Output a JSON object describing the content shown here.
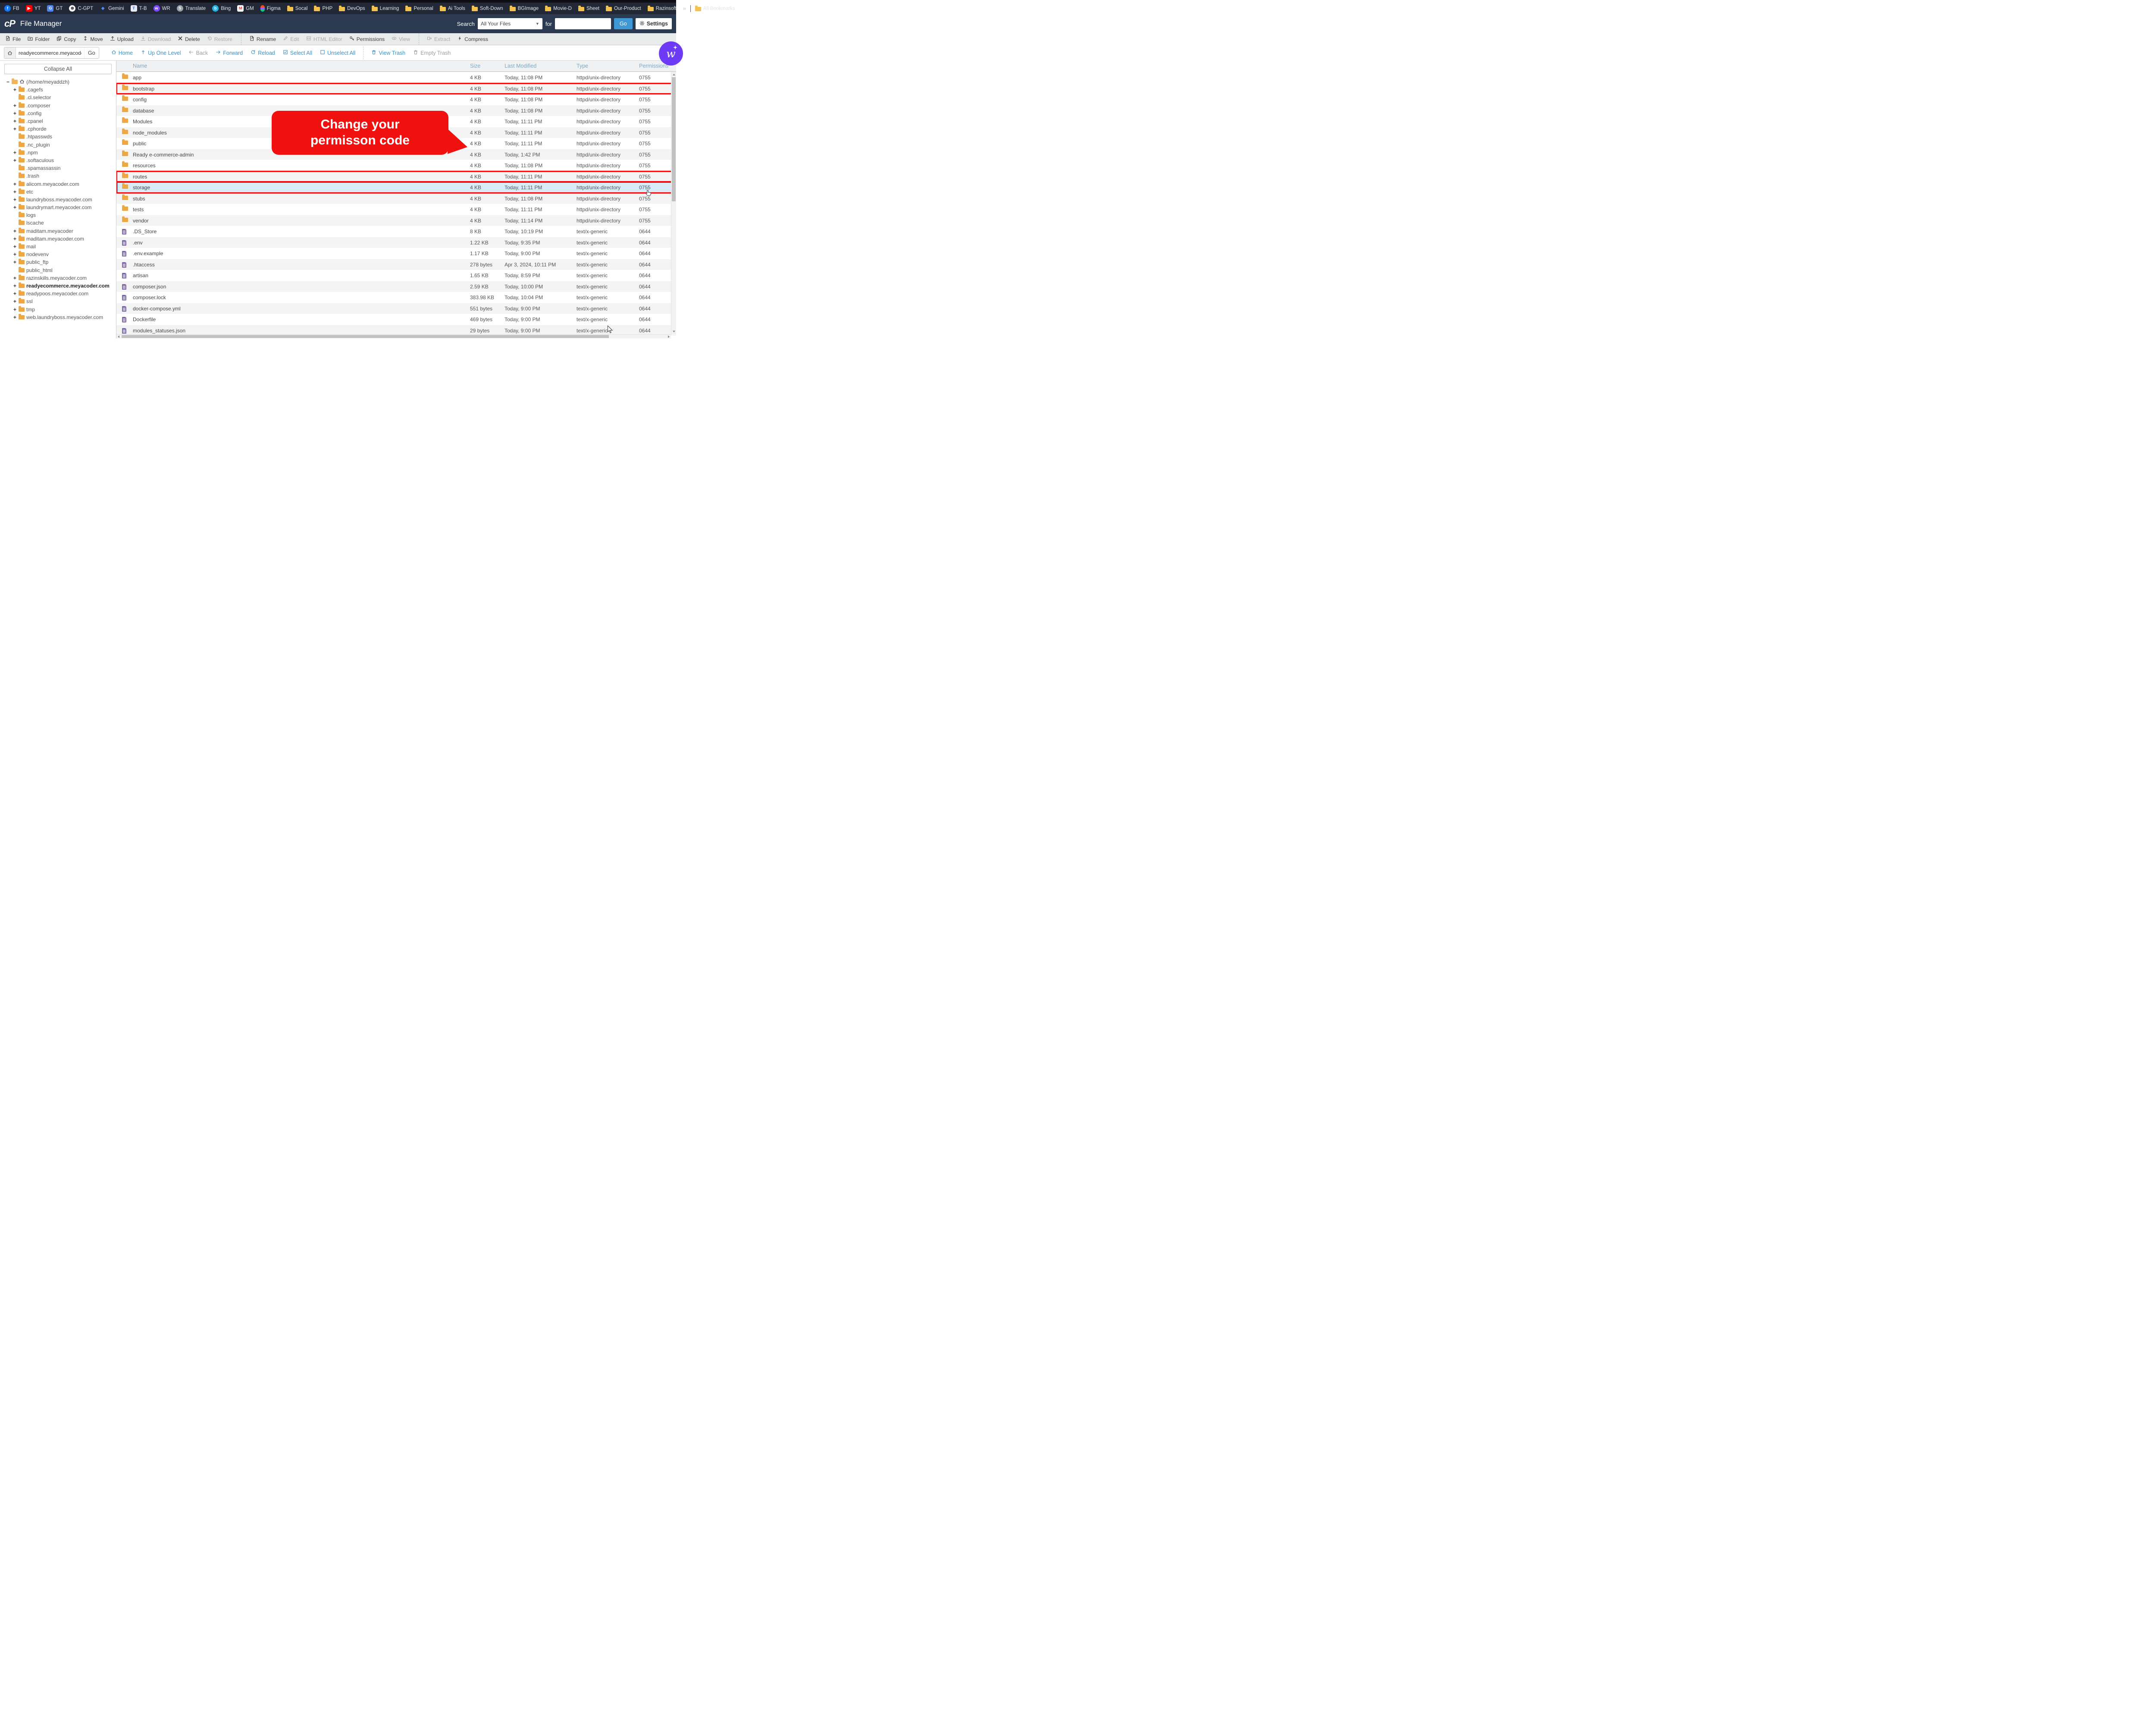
{
  "colors": {
    "accent_blue": "#3f90c4",
    "go_button_blue": "#3e98d3",
    "header_bg": "#2b3a50",
    "bookmark_bar_bg": "#222835",
    "folder_icon": "#eda744",
    "file_icon": "#7e68ab",
    "selected_row_bg": "#d7ebf8",
    "highlight_red": "#ee1111",
    "callout_red": "#f01010",
    "fab_purple": "#6d3bf5"
  },
  "browser": {
    "bookmarks": [
      {
        "label": "FB",
        "kind": "site",
        "shape": "circle",
        "bg": "#1877f2",
        "fg": "#ffffff",
        "glyph": "f"
      },
      {
        "label": "YT",
        "kind": "site",
        "shape": "rounded",
        "bg": "#ff0000",
        "fg": "#ffffff",
        "glyph": "▶"
      },
      {
        "label": "GT",
        "kind": "site",
        "shape": "rounded",
        "bg": "#4f86ec",
        "fg": "#ffffff",
        "glyph": "G"
      },
      {
        "label": "C-GPT",
        "kind": "site",
        "shape": "circle",
        "bg": "#ffffff",
        "fg": "#202123",
        "glyph": "⊛"
      },
      {
        "label": "Gemini",
        "kind": "site",
        "shape": "plain",
        "bg": "transparent",
        "fg": "#4e8df6",
        "glyph": "◆"
      },
      {
        "label": "T-B",
        "kind": "site",
        "shape": "rounded",
        "bg": "#e8ecf9",
        "fg": "#3b5bdb",
        "glyph": "T"
      },
      {
        "label": "WR",
        "kind": "site",
        "shape": "circle",
        "bg": "#7c4dff",
        "fg": "#ffffff",
        "glyph": "w"
      },
      {
        "label": "Translate",
        "kind": "site",
        "shape": "circle",
        "bg": "#9aa0a6",
        "fg": "#ffffff",
        "glyph": "S"
      },
      {
        "label": "Bing",
        "kind": "site",
        "shape": "circle",
        "bg": "#2bb3e6",
        "fg": "#ffffff",
        "glyph": "b"
      },
      {
        "label": "GM",
        "kind": "site",
        "shape": "rounded",
        "bg": "#ffffff",
        "fg": "#ea4335",
        "glyph": "M"
      },
      {
        "label": "Figma",
        "kind": "figma"
      },
      {
        "label": "Socal",
        "kind": "folder"
      },
      {
        "label": "PHP",
        "kind": "folder"
      },
      {
        "label": "DevOps",
        "kind": "folder"
      },
      {
        "label": "Learning",
        "kind": "folder"
      },
      {
        "label": "Personal",
        "kind": "folder"
      },
      {
        "label": "Ai Tools",
        "kind": "folder"
      },
      {
        "label": "Soft-Down",
        "kind": "folder"
      },
      {
        "label": "BGImage",
        "kind": "folder"
      },
      {
        "label": "Movie-D",
        "kind": "folder"
      },
      {
        "label": "Sheet",
        "kind": "folder"
      },
      {
        "label": "Our-Product",
        "kind": "folder"
      },
      {
        "label": "Razinsoft",
        "kind": "folder"
      }
    ],
    "overflow_chevron": "»",
    "all_bookmarks_label": "All Bookmarks"
  },
  "header": {
    "logo": "cP",
    "title": "File Manager",
    "search_label": "Search",
    "search_scope_value": "All Your Files",
    "for_label": "for",
    "search_value": "",
    "go_label": "Go",
    "settings_label": "Settings"
  },
  "toolbar": {
    "items": [
      {
        "label": "File",
        "icon": "file-plus",
        "enabled": true
      },
      {
        "label": "Folder",
        "icon": "folder-plus",
        "enabled": true
      },
      {
        "label": "Copy",
        "icon": "copy",
        "enabled": true
      },
      {
        "label": "Move",
        "icon": "move",
        "enabled": true
      },
      {
        "label": "Upload",
        "icon": "upload",
        "enabled": true
      },
      {
        "label": "Download",
        "icon": "download",
        "enabled": false
      },
      {
        "label": "Delete",
        "icon": "delete",
        "enabled": true
      },
      {
        "label": "Restore",
        "icon": "restore",
        "enabled": false
      },
      {
        "sep": true
      },
      {
        "label": "Rename",
        "icon": "rename",
        "enabled": true
      },
      {
        "label": "Edit",
        "icon": "edit",
        "enabled": false
      },
      {
        "label": "HTML Editor",
        "icon": "html-editor",
        "enabled": false
      },
      {
        "label": "Permissions",
        "icon": "key",
        "enabled": true
      },
      {
        "label": "View",
        "icon": "eye",
        "enabled": false
      },
      {
        "sep": true
      },
      {
        "label": "Extract",
        "icon": "extract",
        "enabled": false
      },
      {
        "label": "Compress",
        "icon": "compress",
        "enabled": true
      }
    ]
  },
  "navbar": {
    "path": {
      "value": "readyecommerce.meyacoder.c",
      "go_label": "Go"
    },
    "items": [
      {
        "label": "Home",
        "icon": "home",
        "enabled": true
      },
      {
        "label": "Up One Level",
        "icon": "up-level",
        "enabled": true
      },
      {
        "label": "Back",
        "icon": "back",
        "enabled": false
      },
      {
        "label": "Forward",
        "icon": "forward",
        "enabled": true
      },
      {
        "label": "Reload",
        "icon": "reload",
        "enabled": true
      },
      {
        "label": "Select All",
        "icon": "checkbox-checked",
        "enabled": true
      },
      {
        "label": "Unselect All",
        "icon": "checkbox-empty",
        "enabled": true
      },
      {
        "sep": true
      },
      {
        "label": "View Trash",
        "icon": "trash",
        "enabled": true
      },
      {
        "label": "Empty Trash",
        "icon": "trash",
        "enabled": false
      }
    ]
  },
  "sidebar": {
    "collapse_all_label": "Collapse All",
    "expand_glyph": "+",
    "collapse_glyph": "−",
    "tree": [
      {
        "label": "(/home/meyaddzh)",
        "root": true
      },
      {
        "label": ".cagefs",
        "plus": true
      },
      {
        "label": ".cl.selector",
        "plus": false
      },
      {
        "label": ".composer",
        "plus": true
      },
      {
        "label": ".config",
        "plus": true
      },
      {
        "label": ".cpanel",
        "plus": true
      },
      {
        "label": ".cphorde",
        "plus": true
      },
      {
        "label": ".htpasswds",
        "plus": false
      },
      {
        "label": ".nc_plugin",
        "plus": false
      },
      {
        "label": ".npm",
        "plus": true
      },
      {
        "label": ".softaculous",
        "plus": true
      },
      {
        "label": ".spamassassin",
        "plus": false
      },
      {
        "label": ".trash",
        "plus": false
      },
      {
        "label": "alicom.meyacoder.com",
        "plus": true
      },
      {
        "label": "etc",
        "plus": true
      },
      {
        "label": "laundryboss.meyacoder.com",
        "plus": true
      },
      {
        "label": "laundrymart.meyacoder.com",
        "plus": true
      },
      {
        "label": "logs",
        "plus": false
      },
      {
        "label": "lscache",
        "plus": false
      },
      {
        "label": "maditam.meyacoder",
        "plus": true
      },
      {
        "label": "maditam.meyacoder.com",
        "plus": true
      },
      {
        "label": "mail",
        "plus": true
      },
      {
        "label": "nodevenv",
        "plus": true
      },
      {
        "label": "public_ftp",
        "plus": true
      },
      {
        "label": "public_html",
        "plus": false
      },
      {
        "label": "razinskills.meyacoder.com",
        "plus": true
      },
      {
        "label": "readyecommerce.meyacoder.com",
        "plus": true,
        "bold": true
      },
      {
        "label": "readypoos.meyacoder.com",
        "plus": true
      },
      {
        "label": "ssl",
        "plus": true
      },
      {
        "label": "tmp",
        "plus": true
      },
      {
        "label": "web.laundryboss.meyacoder.com",
        "plus": true
      }
    ]
  },
  "table": {
    "columns": [
      "Name",
      "Size",
      "Last Modified",
      "Type",
      "Permissions"
    ],
    "rows": [
      {
        "name": "app",
        "kind": "folder",
        "size": "4 KB",
        "modified": "Today, 11:08 PM",
        "type": "httpd/unix-directory",
        "perms": "0755",
        "red_box": false,
        "selected": false
      },
      {
        "name": "bootstrap",
        "kind": "folder",
        "size": "4 KB",
        "modified": "Today, 11:08 PM",
        "type": "httpd/unix-directory",
        "perms": "0755",
        "red_box": true,
        "selected": false
      },
      {
        "name": "config",
        "kind": "folder",
        "size": "4 KB",
        "modified": "Today, 11:08 PM",
        "type": "httpd/unix-directory",
        "perms": "0755",
        "red_box": false,
        "selected": false
      },
      {
        "name": "database",
        "kind": "folder",
        "size": "4 KB",
        "modified": "Today, 11:08 PM",
        "type": "httpd/unix-directory",
        "perms": "0755",
        "red_box": false,
        "selected": false
      },
      {
        "name": "Modules",
        "kind": "folder",
        "size": "4 KB",
        "modified": "Today, 11:11 PM",
        "type": "httpd/unix-directory",
        "perms": "0755",
        "red_box": false,
        "selected": false
      },
      {
        "name": "node_modules",
        "kind": "folder",
        "size": "4 KB",
        "modified": "Today, 11:11 PM",
        "type": "httpd/unix-directory",
        "perms": "0755",
        "red_box": false,
        "selected": false
      },
      {
        "name": "public",
        "kind": "folder",
        "size": "4 KB",
        "modified": "Today, 11:11 PM",
        "type": "httpd/unix-directory",
        "perms": "0755",
        "red_box": false,
        "selected": false
      },
      {
        "name": "Ready e-commerce-admin",
        "kind": "folder",
        "size": "4 KB",
        "modified": "Today, 1:42 PM",
        "type": "httpd/unix-directory",
        "perms": "0755",
        "red_box": false,
        "selected": false
      },
      {
        "name": "resources",
        "kind": "folder",
        "size": "4 KB",
        "modified": "Today, 11:08 PM",
        "type": "httpd/unix-directory",
        "perms": "0755",
        "red_box": false,
        "selected": false
      },
      {
        "name": "routes",
        "kind": "folder",
        "size": "4 KB",
        "modified": "Today, 11:11 PM",
        "type": "httpd/unix-directory",
        "perms": "0755",
        "red_box": true,
        "selected": false
      },
      {
        "name": "storage",
        "kind": "folder",
        "size": "4 KB",
        "modified": "Today, 11:11 PM",
        "type": "httpd/unix-directory",
        "perms": "0755",
        "red_box": true,
        "selected": true
      },
      {
        "name": "stubs",
        "kind": "folder",
        "size": "4 KB",
        "modified": "Today, 11:08 PM",
        "type": "httpd/unix-directory",
        "perms": "0755",
        "red_box": false,
        "selected": false
      },
      {
        "name": "tests",
        "kind": "folder",
        "size": "4 KB",
        "modified": "Today, 11:11 PM",
        "type": "httpd/unix-directory",
        "perms": "0755",
        "red_box": false,
        "selected": false
      },
      {
        "name": "vendor",
        "kind": "folder",
        "size": "4 KB",
        "modified": "Today, 11:14 PM",
        "type": "httpd/unix-directory",
        "perms": "0755",
        "red_box": false,
        "selected": false
      },
      {
        "name": ".DS_Store",
        "kind": "file",
        "size": "8 KB",
        "modified": "Today, 10:19 PM",
        "type": "text/x-generic",
        "perms": "0644",
        "red_box": false,
        "selected": false
      },
      {
        "name": ".env",
        "kind": "file",
        "size": "1.22 KB",
        "modified": "Today, 9:35 PM",
        "type": "text/x-generic",
        "perms": "0644",
        "red_box": false,
        "selected": false
      },
      {
        "name": ".env.example",
        "kind": "file",
        "size": "1.17 KB",
        "modified": "Today, 9:00 PM",
        "type": "text/x-generic",
        "perms": "0644",
        "red_box": false,
        "selected": false
      },
      {
        "name": ".htaccess",
        "kind": "file",
        "size": "278 bytes",
        "modified": "Apr 3, 2024, 10:11 PM",
        "type": "text/x-generic",
        "perms": "0644",
        "red_box": false,
        "selected": false
      },
      {
        "name": "artisan",
        "kind": "file",
        "size": "1.65 KB",
        "modified": "Today, 8:59 PM",
        "type": "text/x-generic",
        "perms": "0644",
        "red_box": false,
        "selected": false
      },
      {
        "name": "composer.json",
        "kind": "file",
        "size": "2.59 KB",
        "modified": "Today, 10:00 PM",
        "type": "text/x-generic",
        "perms": "0644",
        "red_box": false,
        "selected": false
      },
      {
        "name": "composer.lock",
        "kind": "file",
        "size": "383.98 KB",
        "modified": "Today, 10:04 PM",
        "type": "text/x-generic",
        "perms": "0644",
        "red_box": false,
        "selected": false
      },
      {
        "name": "docker-compose.yml",
        "kind": "file",
        "size": "551 bytes",
        "modified": "Today, 9:00 PM",
        "type": "text/x-generic",
        "perms": "0644",
        "red_box": false,
        "selected": false
      },
      {
        "name": "Dockerfile",
        "kind": "file",
        "size": "469 bytes",
        "modified": "Today, 9:00 PM",
        "type": "text/x-generic",
        "perms": "0644",
        "red_box": false,
        "selected": false
      },
      {
        "name": "modules_statuses.json",
        "kind": "file",
        "size": "29 bytes",
        "modified": "Today, 9:00 PM",
        "type": "text/x-generic",
        "perms": "0644",
        "red_box": false,
        "selected": false
      }
    ]
  },
  "callout": {
    "line1": "Change your",
    "line2": "permisson code"
  },
  "fab": {
    "glyph": "w"
  }
}
